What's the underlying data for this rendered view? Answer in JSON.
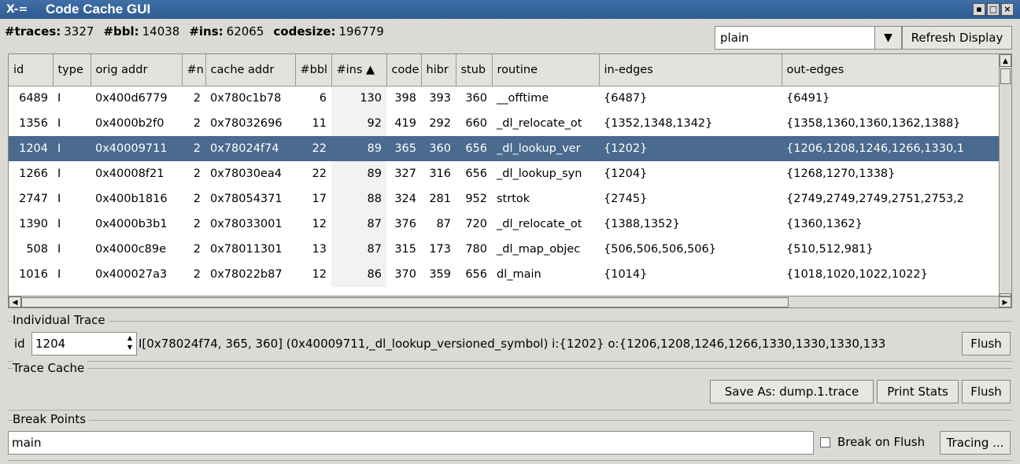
{
  "window": {
    "title": "Code Cache GUI",
    "logo": "X-="
  },
  "stats": {
    "traces_label": "#traces:",
    "traces": "3327",
    "bbl_label": "#bbl:",
    "bbl": "14038",
    "ins_label": "#ins:",
    "ins": "62065",
    "codesize_label": "codesize:",
    "codesize": "196779"
  },
  "view_select": {
    "value": "plain"
  },
  "refresh_label": "Refresh Display",
  "table": {
    "columns": [
      "id",
      "type",
      "orig addr",
      "#n",
      "cache addr",
      "#bbl",
      "#ins ▲",
      "code",
      "hibr",
      "stub",
      "routine",
      "in-edges",
      "out-edges"
    ],
    "rows": [
      [
        "6489",
        "I",
        "0x400d6779",
        "2",
        "0x780c1b78",
        "6",
        "130",
        "398",
        "393",
        "360",
        "__offtime",
        "{6487}",
        "{6491}"
      ],
      [
        "1356",
        "I",
        "0x4000b2f0",
        "2",
        "0x78032696",
        "11",
        "92",
        "419",
        "292",
        "660",
        "_dl_relocate_ot",
        "{1352,1348,1342}",
        "{1358,1360,1360,1362,1388}"
      ],
      [
        "1204",
        "I",
        "0x40009711",
        "2",
        "0x78024f74",
        "22",
        "89",
        "365",
        "360",
        "656",
        "_dl_lookup_ver",
        "{1202}",
        "{1206,1208,1246,1266,1330,1"
      ],
      [
        "1266",
        "I",
        "0x40008f21",
        "2",
        "0x78030ea4",
        "22",
        "89",
        "327",
        "316",
        "656",
        "_dl_lookup_syn",
        "{1204}",
        "{1268,1270,1338}"
      ],
      [
        "2747",
        "I",
        "0x400b1816",
        "2",
        "0x78054371",
        "17",
        "88",
        "324",
        "281",
        "952",
        "strtok",
        "{2745}",
        "{2749,2749,2749,2751,2753,2"
      ],
      [
        "1390",
        "I",
        "0x4000b3b1",
        "2",
        "0x78033001",
        "12",
        "87",
        "376",
        "87",
        "720",
        "_dl_relocate_ot",
        "{1388,1352}",
        "{1360,1362}"
      ],
      [
        "508",
        "I",
        "0x4000c89e",
        "2",
        "0x78011301",
        "13",
        "87",
        "315",
        "173",
        "780",
        "_dl_map_objec",
        "{506,506,506,506}",
        "{510,512,981}"
      ],
      [
        "1016",
        "I",
        "0x400027a3",
        "2",
        "0x78022b87",
        "12",
        "86",
        "370",
        "359",
        "656",
        "dl_main",
        "{1014}",
        "{1018,1020,1022,1022}"
      ]
    ],
    "selected_row": 2
  },
  "individual_trace": {
    "group_label": "Individual Trace",
    "id_label": "id",
    "id_value": "1204",
    "info": "I[0x78024f74, 365, 360]  (0x40009711,_dl_lookup_versioned_symbol)  i:{1202}  o:{1206,1208,1246,1266,1330,1330,1330,133",
    "flush_label": "Flush"
  },
  "trace_cache": {
    "group_label": "Trace Cache",
    "save_label": "Save As: dump.1.trace",
    "print_label": "Print Stats",
    "flush_label": "Flush"
  },
  "break_points": {
    "group_label": "Break Points",
    "value": "main",
    "break_on_flush_label": "Break on Flush",
    "tracing_label": "Tracing ..."
  }
}
